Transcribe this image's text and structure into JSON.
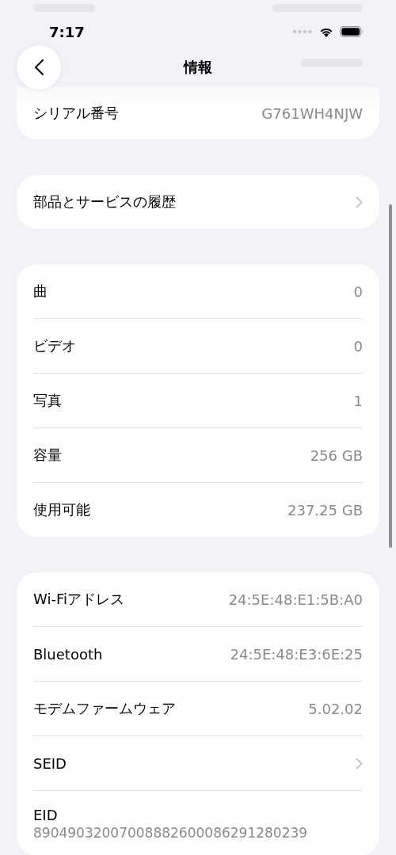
{
  "status_bar": {
    "time": "7:17"
  },
  "nav": {
    "title": "情報"
  },
  "sections": [
    {
      "rows": [
        {
          "kind": "value",
          "label": "シリアル番号",
          "value": "G761WH4NJW"
        }
      ]
    },
    {
      "rows": [
        {
          "kind": "link",
          "label": "部品とサービスの履歴"
        }
      ]
    },
    {
      "rows": [
        {
          "kind": "value",
          "label": "曲",
          "value": "0"
        },
        {
          "kind": "value",
          "label": "ビデオ",
          "value": "0"
        },
        {
          "kind": "value",
          "label": "写真",
          "value": "1"
        },
        {
          "kind": "value",
          "label": "容量",
          "value": "256 GB"
        },
        {
          "kind": "value",
          "label": "使用可能",
          "value": "237.25 GB"
        }
      ]
    },
    {
      "rows": [
        {
          "kind": "value",
          "label": "Wi-Fiアドレス",
          "value": "24:5E:48:E1:5B:A0"
        },
        {
          "kind": "value",
          "label": "Bluetooth",
          "value": "24:5E:48:E3:6E:25"
        },
        {
          "kind": "value",
          "label": "モデムファームウェア",
          "value": "5.02.02"
        },
        {
          "kind": "link",
          "label": "SEID"
        },
        {
          "kind": "stacked",
          "label": "EID",
          "value": "89049032007008882600086291280239"
        }
      ]
    }
  ]
}
